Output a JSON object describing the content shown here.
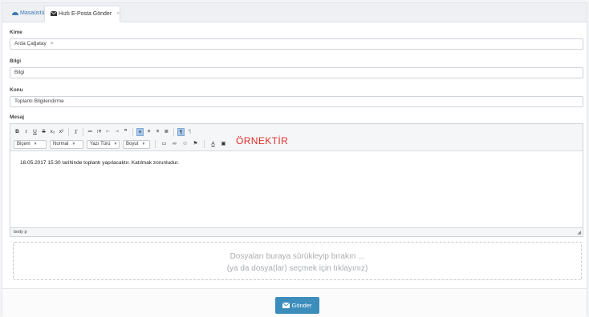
{
  "tabs": [
    {
      "label": "Masaüstü",
      "icon": "dashboard-icon"
    },
    {
      "label": "Hızlı E-Posta Gönder",
      "icon": "envelope-icon",
      "close": "×"
    }
  ],
  "form": {
    "to": {
      "label": "Kime",
      "token": "Arda Çağatay",
      "token_remove": "×"
    },
    "cc": {
      "label": "Bilgi",
      "value": "Bilgi"
    },
    "subject": {
      "label": "Konu",
      "value": "Toplantı Bilgilendirme"
    },
    "message": {
      "label": "Mesaj"
    }
  },
  "editor": {
    "format_style": "Biçem",
    "format_paragraph": "Normal",
    "font": "Yazı Türü",
    "size": "Boyut",
    "sample_label": "ÖRNEKTİR",
    "content": "18.05.2017  15:30 tarihinde toplantı yapılacaktır. Katılmak zorunludur.",
    "path": "body  p"
  },
  "dropzone": {
    "line1": "Dosyaları buraya sürükleyip bırakın ...",
    "line2": "(ya da dosya(lar) seçmek için tıklayınız)"
  },
  "actions": {
    "send_label": "Gönder"
  },
  "colors": {
    "primary": "#3c8dbc",
    "sample": "#e0302a",
    "link": "#3b79b6"
  }
}
